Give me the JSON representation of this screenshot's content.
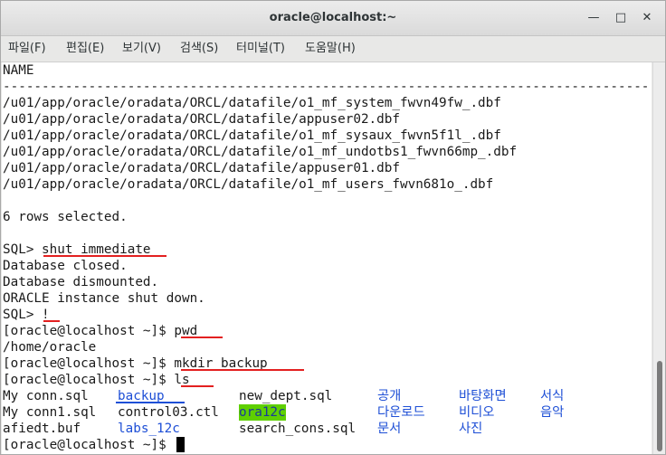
{
  "window": {
    "title": "oracle@localhost:~"
  },
  "menu": [
    "파일(F)",
    "편집(E)",
    "보기(V)",
    "검색(S)",
    "터미널(T)",
    "도움말(H)"
  ],
  "terminal": {
    "lines": [
      "NAME",
      "",
      "/u01/app/oracle/oradata/ORCL/datafile/o1_mf_system_fwvn49fw_.dbf",
      "/u01/app/oracle/oradata/ORCL/datafile/appuser02.dbf",
      "/u01/app/oracle/oradata/ORCL/datafile/o1_mf_sysaux_fwvn5f1l_.dbf",
      "/u01/app/oracle/oradata/ORCL/datafile/o1_mf_undotbs1_fwvn66mp_.dbf",
      "/u01/app/oracle/oradata/ORCL/datafile/appuser01.dbf",
      "/u01/app/oracle/oradata/ORCL/datafile/o1_mf_users_fwvn681o_.dbf",
      "",
      "6 rows selected.",
      "",
      "SQL> shut immediate",
      "Database closed.",
      "Database dismounted.",
      "ORACLE instance shut down.",
      "SQL> !",
      "[oracle@localhost ~]$ pwd",
      "/home/oracle",
      "[oracle@localhost ~]$ mkdir backup",
      "[oracle@localhost ~]$ ls"
    ],
    "dashes": "------------------------------------------------------------------------------------------------------------------------",
    "ls_rows": [
      [
        "My conn.sql",
        "backup",
        "new_dept.sql",
        "공개",
        "바탕화면",
        "서식"
      ],
      [
        "My conn1.sql",
        "control03.ctl",
        "ora12c",
        "다운로드",
        "비디오",
        "음악"
      ],
      [
        "afiedt.buf",
        "labs_12c",
        "search_cons.sql",
        "문서",
        "사진",
        ""
      ]
    ],
    "prompt": "[oracle@localhost ~]$ "
  },
  "colors": {
    "underline": "#e32020",
    "directory": "#1e4fd6",
    "highlight": "#5fd000"
  }
}
